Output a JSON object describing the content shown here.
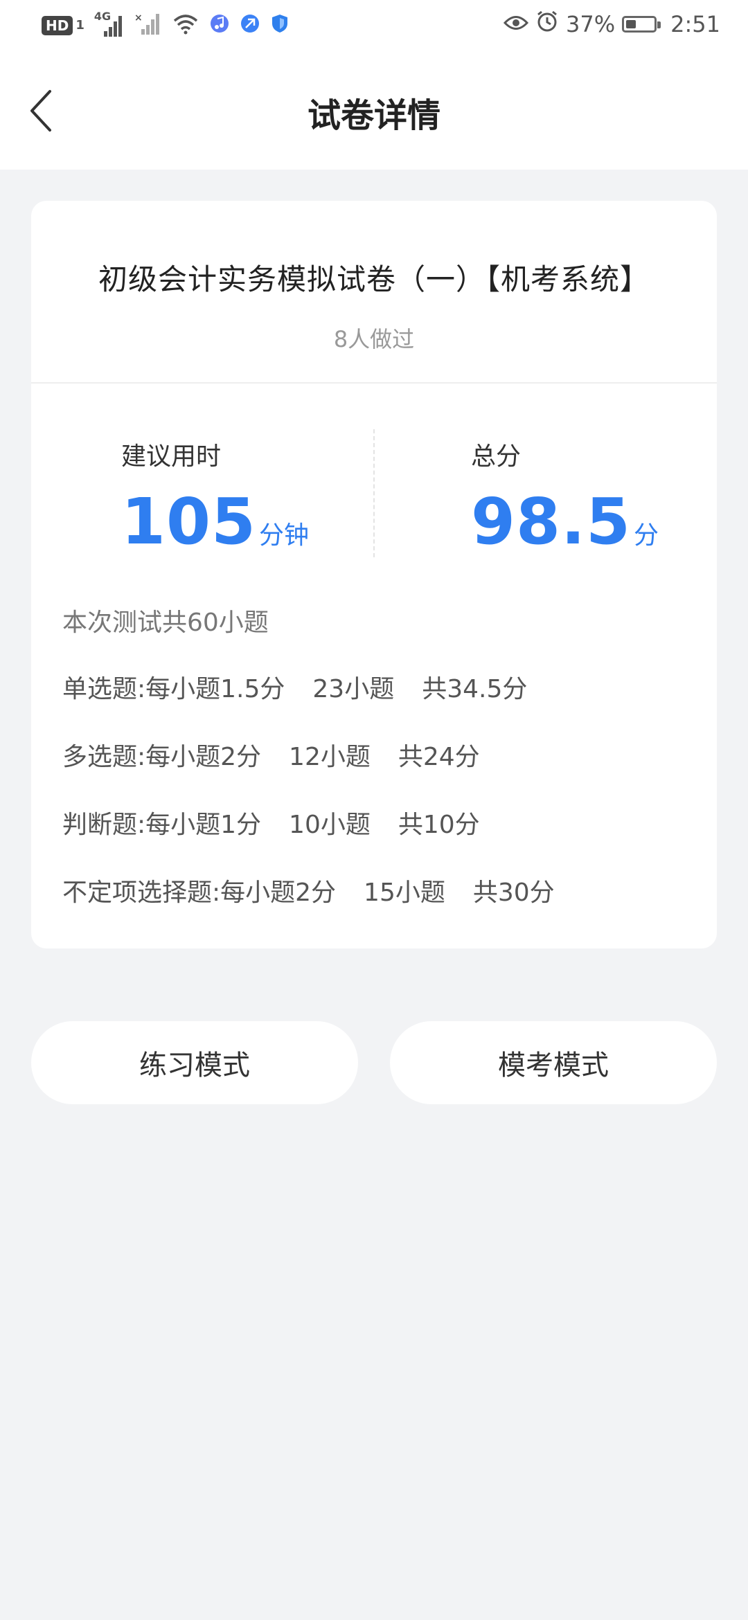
{
  "status_bar": {
    "hd": "HD",
    "sim_id": "1",
    "network_type": "4G",
    "battery_percent_text": "37%",
    "battery_level": 0.37,
    "time": "2:51",
    "icons": [
      "hd-badge",
      "signal-icon",
      "signal-no-sim-icon",
      "wifi-icon",
      "music-app-icon",
      "browser-app-icon",
      "shield-app-icon",
      "eye-icon",
      "alarm-icon",
      "battery-icon"
    ],
    "colors": {
      "music": "#5b7cf5",
      "browser": "#3b82f6",
      "shield": "#2f80ed"
    }
  },
  "header": {
    "title": "试卷详情",
    "back_icon": "chevron-left-icon"
  },
  "paper": {
    "title": "初级会计实务模拟试卷（一）【机考系统】",
    "done_count": "8人做过",
    "suggested_time_label": "建议用时",
    "suggested_time_value": "105",
    "suggested_time_unit": "分钟",
    "total_score_label": "总分",
    "total_score_value": "98.5",
    "total_score_unit": "分",
    "summary": "本次测试共60小题",
    "question_types": [
      {
        "type_desc": "单选题:每小题1.5分",
        "count": "23小题",
        "total": "共34.5分"
      },
      {
        "type_desc": "多选题:每小题2分",
        "count": "12小题",
        "total": "共24分"
      },
      {
        "type_desc": "判断题:每小题1分",
        "count": "10小题",
        "total": "共10分"
      },
      {
        "type_desc": "不定项选择题:每小题2分",
        "count": "15小题",
        "total": "共30分"
      }
    ]
  },
  "actions": {
    "practice_mode": "练习模式",
    "exam_mode": "模考模式"
  },
  "theme": {
    "accent": "#2f7ef0",
    "background": "#f2f3f5",
    "card": "#ffffff"
  }
}
